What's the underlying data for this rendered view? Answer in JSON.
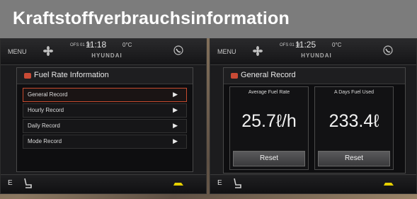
{
  "banner": {
    "title": "Kraftstoffverbrauchsinformation"
  },
  "status": {
    "menu": "MENU",
    "date": "OFS 01 18",
    "brand": "HYUNDAI",
    "temp": "0°C",
    "time_left": "11:18",
    "time_right": "11:25"
  },
  "left_screen": {
    "header": "Fuel Rate Information",
    "items": [
      {
        "label": "General Record",
        "arrow": "▶"
      },
      {
        "label": "Hourly Record",
        "arrow": "▶"
      },
      {
        "label": "Daily Record",
        "arrow": "▶"
      },
      {
        "label": "Mode Record",
        "arrow": "▶"
      }
    ]
  },
  "right_screen": {
    "header": "General Record",
    "avg": {
      "label": "Average Fuel Rate",
      "value": "25.7ℓ/h",
      "reset": "Reset"
    },
    "day": {
      "label": "A Days Fuel Used",
      "value": "233.4ℓ",
      "reset": "Reset"
    }
  },
  "bottom": {
    "e_label": "E"
  },
  "colors": {
    "banner": "#7c7c7c",
    "accent": "#c64b2e",
    "car": "#e6d000"
  },
  "icons": [
    "fan-icon",
    "phone-icon",
    "seat-icon",
    "car-icon",
    "fuel-pump-icon"
  ]
}
